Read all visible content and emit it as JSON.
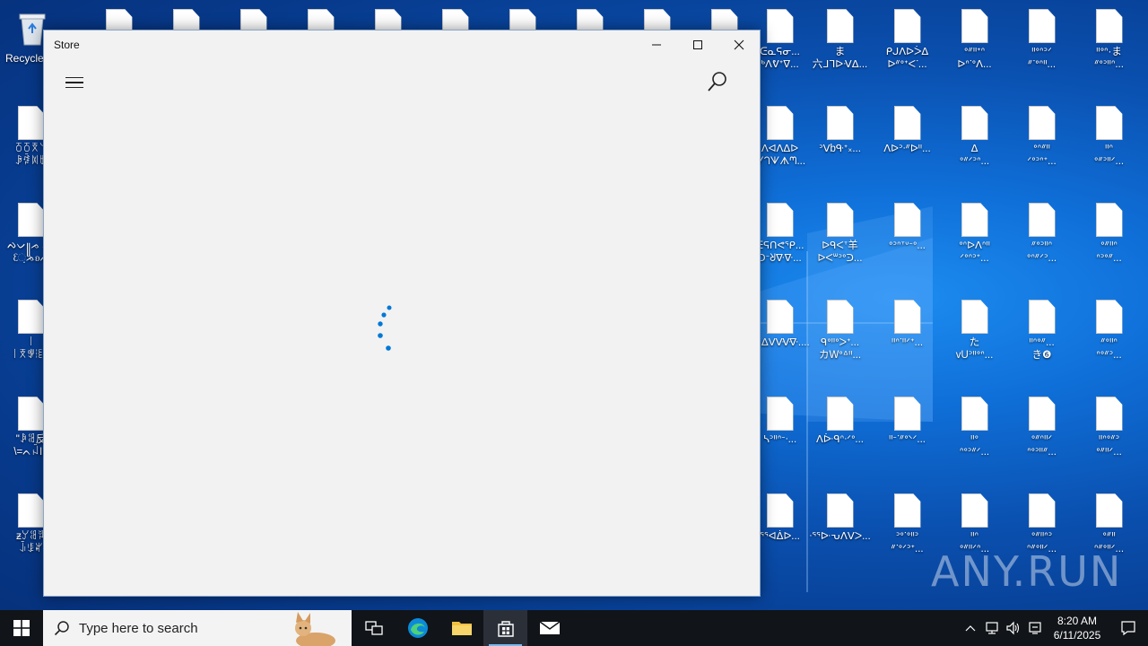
{
  "desktop": {
    "recycle_bin_label": "Recycle",
    "icons_col_0": [
      {
        "label": "ꅁꅂꅃ꒡\nꆃꆄꂀꁁ"
      },
      {
        "label": "ᨄᨆ꧋ᨍ ᨓ\nᦷᨘᨍᦈᨊ"
      },
      {
        "label": "꒐\n꒐ꅃꅚꊫꋶ"
      },
      {
        "label": "\"ꀲꌃ反\n\\=ᨈꈣIn"
      },
      {
        "label": "ᵶꌦꌃꆍ\nꀭꌐꊍ"
      }
    ],
    "icons_col_10": [
      {
        "label": "ᕮᓇᕋᓂ...\nᒃᐱᕓᐩᐁ..."
      },
      {
        "label": "ᐱᐊᐱᐃᐅ\nᗐᘃᗐᗑᘉ..."
      },
      {
        "label": "ᕮᕋᑎᕙᕿ...\nᑐᐨᖈᐍᐍ..."
      },
      {
        "label": "ᐫᐃᐯᐻᐻᐍ...."
      },
      {
        "label": "ᓴᐣᐦᐢᐨᐧ..."
      },
      {
        "label": "ᕐᕐᐊᐄᐅ..."
      }
    ],
    "icons_col_11": [
      {
        "label": "ま\n六ᒧᒣᐅᐺᐃ..."
      },
      {
        "label": "ᐣᐯbᑵᐩ᙮..."
      },
      {
        "label": "ᐅᑫᐸᐪ羊\nᐅᐸᐜᐣᐤᑔ..."
      },
      {
        "label": "ᑫᐤᐦᐤᐳᐩ...\nカWᐤᐞᐦ..."
      },
      {
        "label": "ᐱᐕᑫᐢᐧᐟᐤ..."
      },
      {
        "label": "ᐧᕐᕐᐓᕃᐱᐯᐳ..."
      }
    ],
    "icons_col_12": [
      {
        "label": "ᑭᒍᐱᐅᐴᐃ\nᐅᐥᐤᐩᐸᐝ..."
      },
      {
        "label": "ᐱᐅᐣᐧᐥᐅᐦ..."
      },
      {
        "label": "ᐤᐣᐢᐪᐡᐨᐤ..."
      },
      {
        "label": "ᐦᐢᐝᐦᐟᐩ..."
      },
      {
        "label": "ᐦᐨᐝᐥᐤᐠᐟ..."
      },
      {
        "label": "ᐣᐤᐝᐤᐦᐣ\nᐥᐝᐤᐟᐣᐩ..."
      }
    ],
    "icons_col_13": [
      {
        "label": "ᐤᐥᐦᐩᐢ\nᐅᐢᐝᐤᐱ..."
      },
      {
        "label": "ᐃ\nᐤᐥᐟᐣᐢ..."
      },
      {
        "label": "ᐤᐢᐅᐱᐢᐦ\nᐟᐤᐢᐣᐩ..."
      },
      {
        "label": "た\nvUᐣᐦᐤᐢ..."
      },
      {
        "label": "ᐦᐤ\nᐢᐤᐣᐥᐟ..."
      },
      {
        "label": "ᐦᐢ\nᐤᐥᐦᐟᐢ..."
      }
    ],
    "icons_col_14": [
      {
        "label": "ᐦᐤᐢᐣᐟ\nᐥᐝᐤᐢᐦ..."
      },
      {
        "label": "ᐤᐢᐥᐦ\nᐟᐤᐣᐢᐩ..."
      },
      {
        "label": "ᐥᐤᐣᐦᐢ\nᐤᐢᐥᐟᐣ..."
      },
      {
        "label": "ᐦᐢᐤᐥ...\nき❻"
      },
      {
        "label": "ᐤᐥᐢᐦᐟ\nᐢᐤᐣᐦᐥ..."
      },
      {
        "label": "ᐤᐥᐦᐢᐣ\nᐢᐥᐤᐦᐟ..."
      }
    ],
    "icons_col_15": [
      {
        "label": "ᐦᐤᐢ·ま\nᐥᐤᐣᐦᐢ..."
      },
      {
        "label": "ᐦᐢ\nᐤᐥᐣᐦᐟ..."
      },
      {
        "label": "ᐤᐥᐦᐢ\nᐢᐣᐤᐥ..."
      },
      {
        "label": "ᐥᐤᐦᐢ\nᐢᐤᐥᐣ..."
      },
      {
        "label": "ᐦᐢᐤᐥᐣ\nᐤᐥᐦᐟ..."
      },
      {
        "label": "ᐤᐥᐦ\nᐢᐥᐤᐦᐟ..."
      }
    ]
  },
  "window": {
    "title": "Store",
    "minimize_glyph": "—",
    "maximize_glyph": "☐",
    "close_glyph": "✕",
    "state": "loading"
  },
  "taskbar": {
    "search_placeholder": "Type here to search",
    "time": "8:20 AM",
    "date": "6/11/2025"
  },
  "watermark": "ANY.RUN",
  "colors": {
    "accent": "#0078d7",
    "window_bg": "#f2f2f2",
    "taskbar_bg": "#111418"
  }
}
